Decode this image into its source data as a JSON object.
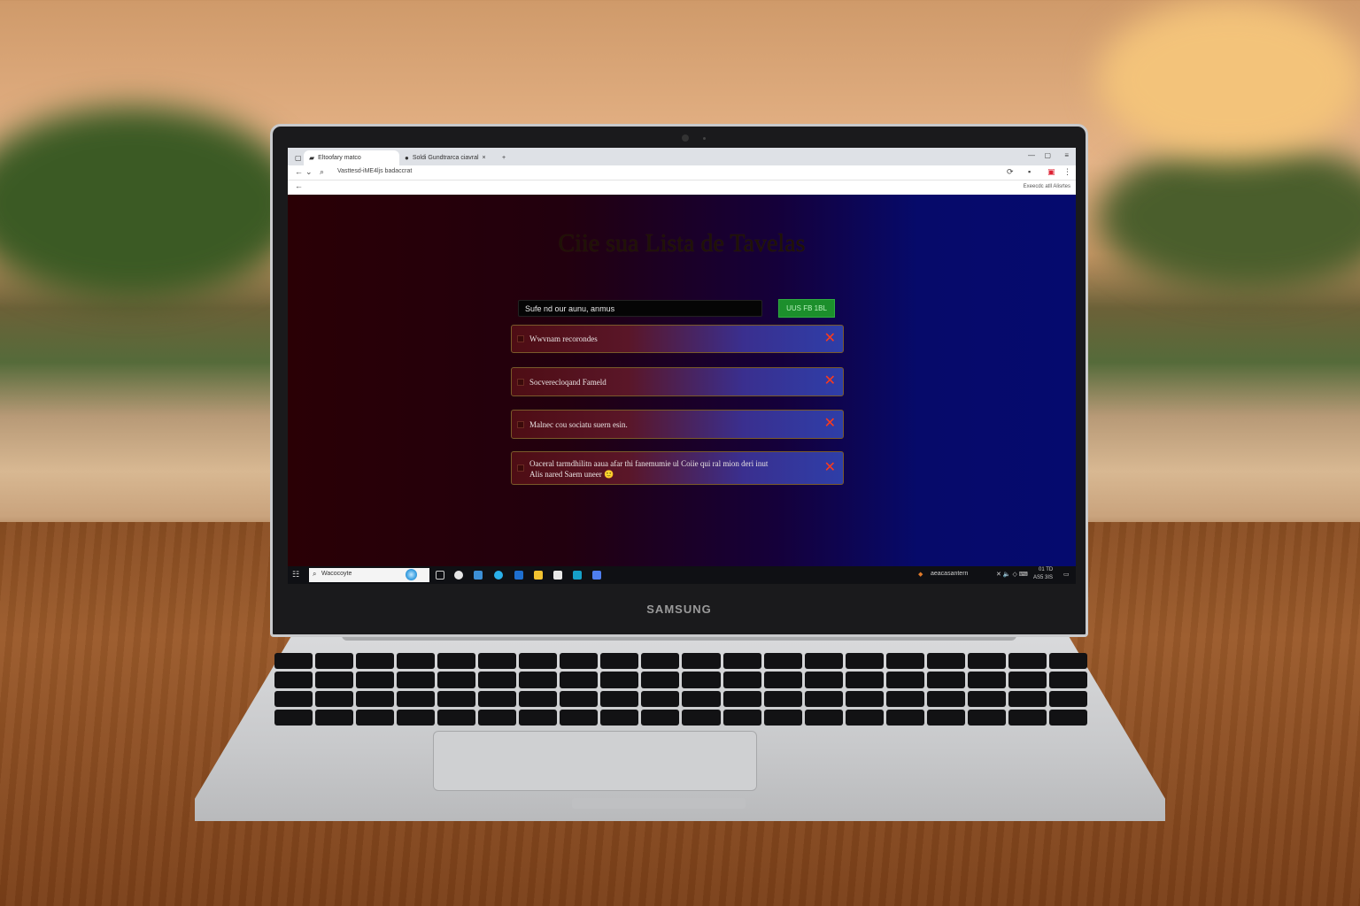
{
  "scene": {
    "laptop_brand": "SAMSUNG"
  },
  "browser": {
    "tabs": [
      {
        "label": "Eltoofary matco",
        "icon": "document-icon",
        "active": true
      },
      {
        "label": "Soldi Gundtrarca ciavral",
        "icon": "globe-icon",
        "active": false
      }
    ],
    "new_tab_icon": "plus-icon",
    "url": "Vasttesd-iME4ljs badaccrat",
    "bookmarks_right": "Exeecdc atll Alisrtes"
  },
  "page": {
    "title": "Ciie sua Lista de Tavelas",
    "input_value": "Sufe nd our aunu, anmus",
    "add_button": "UUS FB 1BL",
    "tasks": [
      {
        "text": "Wwvnam recorondes",
        "delete_icon": "close-icon"
      },
      {
        "text": "Socverecloqand  Fameld",
        "delete_icon": "close-icon"
      },
      {
        "text": "Malnec cou sociatu suern esin.",
        "delete_icon": "close-icon"
      },
      {
        "text": "Oaceral tarmdhilitn aaua afar thi fanemumie ul Coiie qui ral mion deri inut",
        "text2": "Alis nared Saem uneer 🙂",
        "delete_icon": "close-icon"
      }
    ]
  },
  "taskbar": {
    "search_placeholder": "Wacocoyte",
    "tray_text": "aeacasantern",
    "tray_icons": "✕ 🔈 ◇ ⌨",
    "clock_time": "AS5 3IS",
    "clock_top": "01 TD"
  },
  "colors": {
    "page_left": "#2a0005",
    "page_right": "#050a6e",
    "add_button": "#1c8f2c",
    "delete_x": "#ff3a1a"
  }
}
